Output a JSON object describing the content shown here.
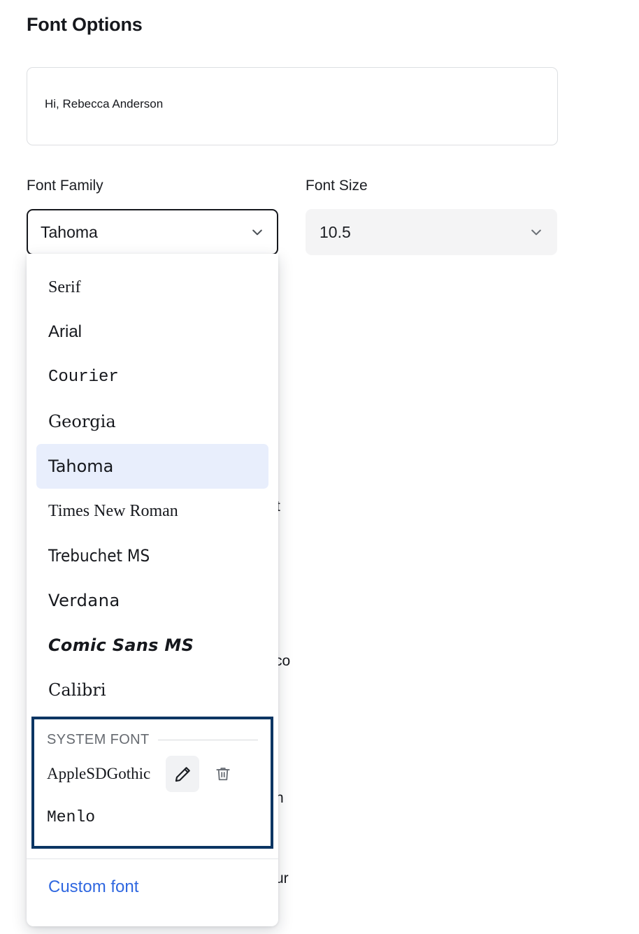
{
  "page": {
    "title": "Font Options"
  },
  "preview": {
    "text": "Hi, Rebecca Anderson"
  },
  "font_family": {
    "label": "Font Family",
    "selected": "Tahoma",
    "chevron_icon": "chevron-down-icon"
  },
  "font_size": {
    "label": "Font Size",
    "selected": "10.5",
    "chevron_icon": "chevron-down-icon"
  },
  "dropdown": {
    "items": [
      {
        "label": "Serif",
        "style": "f-serif",
        "selected": false
      },
      {
        "label": "Arial",
        "style": "f-sans",
        "selected": false
      },
      {
        "label": "Courier",
        "style": "f-mono",
        "selected": false
      },
      {
        "label": "Georgia",
        "style": "f-georgia",
        "selected": false
      },
      {
        "label": "Tahoma",
        "style": "f-tahoma",
        "selected": true
      },
      {
        "label": "Times New Roman",
        "style": "f-times",
        "selected": false
      },
      {
        "label": "Trebuchet MS",
        "style": "f-treb",
        "selected": false
      },
      {
        "label": "Verdana",
        "style": "f-verdana",
        "selected": false
      },
      {
        "label": "Comic Sans MS",
        "style": "f-comic",
        "selected": false
      },
      {
        "label": "Calibri",
        "style": "f-calibri",
        "selected": false
      }
    ],
    "group": {
      "title": "SYSTEM FONT",
      "rows": [
        {
          "label": "AppleSDGothic",
          "style": "f-times",
          "edit_icon": "pencil-icon",
          "delete_icon": "trash-icon"
        },
        {
          "label": "Menlo",
          "style": "f-mono"
        }
      ]
    },
    "footer_link": "Custom font"
  },
  "occluded_background": {
    "fragments": [
      "t",
      "co",
      "n",
      "ur"
    ]
  },
  "colors": {
    "accent_link": "#2f67e0",
    "selected_row_bg": "#e8eefc",
    "focus_ring": "#0b3563",
    "field_bg": "#f4f4f5",
    "text": "#16181d",
    "muted_text": "#666a70"
  }
}
